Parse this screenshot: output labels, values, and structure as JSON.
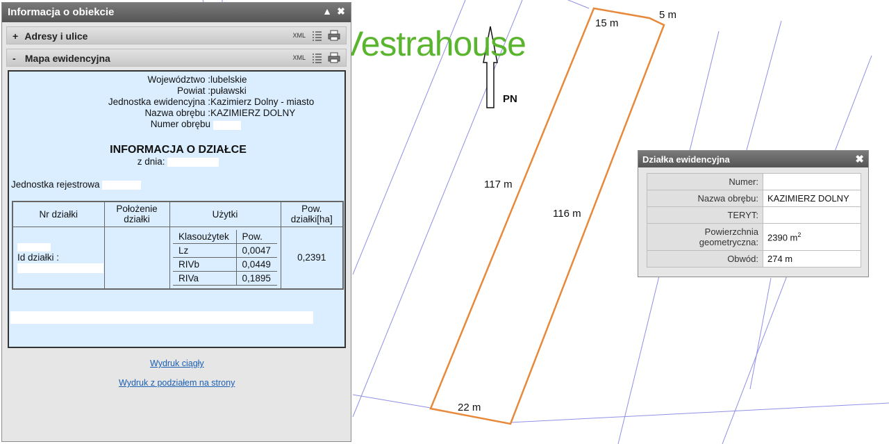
{
  "logo": {
    "text": "Vestrahouse",
    "color": "#5ab52e"
  },
  "map": {
    "north_label": "PN",
    "dimensions": {
      "top_left": "15 m",
      "top_right": "5 m",
      "left_side": "117 m",
      "right_side": "116 m",
      "bottom": "22 m"
    },
    "colors": {
      "parcel_outline": "#e8883a",
      "parcel_lines": "#8f8fe8"
    }
  },
  "panel": {
    "title": "Informacja o obiekcie",
    "sections": [
      {
        "sign": "+",
        "label": "Adresy i ulice",
        "xml": "XML"
      },
      {
        "sign": "-",
        "label": "Mapa ewidencyjna",
        "xml": "XML"
      }
    ],
    "fields": [
      {
        "label": "Województwo :",
        "value": "lubelskie"
      },
      {
        "label": "Powiat :",
        "value": "puławski"
      },
      {
        "label": "Jednostka ewidencyjna :",
        "value": "Kazimierz Dolny - miasto"
      },
      {
        "label": "Nazwa obrębu :",
        "value": "KAZIMIERZ DOLNY"
      },
      {
        "label": "Numer obrębu",
        "value": ""
      }
    ],
    "info_title": "INFORMACJA O DZIAŁCE",
    "z_dnia": "z dnia:",
    "jednostka_rejestrowa": "Jednostka rejestrowa",
    "table": {
      "headers": [
        "Nr działki",
        "Położenie działki",
        "Użytki",
        "Pow. działki[ha]"
      ],
      "id_label": "Id działki :",
      "sub_headers": [
        "Klasoużytek",
        "Pow."
      ],
      "uzytki": [
        {
          "klasa": "Lz",
          "pow": "0,0047"
        },
        {
          "klasa": "RIVb",
          "pow": "0,0449"
        },
        {
          "klasa": "RIVa",
          "pow": "0,1895"
        }
      ],
      "total": "0,2391"
    },
    "links": {
      "continuous": "Wydruk ciągły",
      "paged": "Wydruk z podziałem na strony"
    },
    "colors": {
      "content_bg": "#dbeeff",
      "link": "#1a5fb4"
    }
  },
  "popup": {
    "title": "Działka ewidencyjna",
    "rows": [
      {
        "key": "Numer:",
        "value": ""
      },
      {
        "key": "Nazwa obrębu:",
        "value": "KAZIMIERZ DOLNY"
      },
      {
        "key": "TERYT:",
        "value": ""
      },
      {
        "key": "Powierzchnia geometryczna:",
        "value": "2390 m",
        "sup": "2"
      },
      {
        "key": "Obwód:",
        "value": "274 m"
      }
    ]
  }
}
